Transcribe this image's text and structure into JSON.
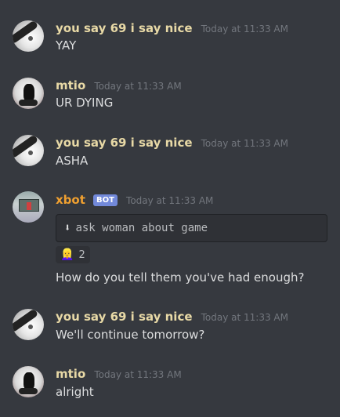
{
  "messages": [
    {
      "author": "you say 69 i say nice",
      "time": "Today at 11:33 AM",
      "text": "YAY",
      "avatar": "white-circle-avatar"
    },
    {
      "author": "mtio",
      "time": "Today at 11:33 AM",
      "text": "UR DYING",
      "avatar": "black-cat-avatar"
    },
    {
      "author": "you say 69 i say nice",
      "time": "Today at 11:33 AM",
      "text": "ASHA",
      "avatar": "white-circle-avatar"
    },
    {
      "author": "xbot",
      "bot_tag": "BOT",
      "time": "Today at 11:33 AM",
      "code": "ask woman about game",
      "code_icon": "down-arrow-icon",
      "reaction": {
        "emoji": "👱‍♀️",
        "count": "2"
      },
      "text": "How do you tell them you've had enough?",
      "avatar": "bot-avatar"
    },
    {
      "author": "you say 69 i say nice",
      "time": "Today at 11:33 AM",
      "text": "We'll continue tomorrow?",
      "avatar": "white-circle-avatar"
    },
    {
      "author": "mtio",
      "time": "Today at 11:33 AM",
      "text": "alright",
      "avatar": "black-cat-avatar"
    }
  ],
  "colors": {
    "background": "#36393f",
    "username": "#e8d9a6",
    "bot_username": "#f0a030",
    "bot_tag": "#7289da",
    "timestamp": "#72767d"
  }
}
